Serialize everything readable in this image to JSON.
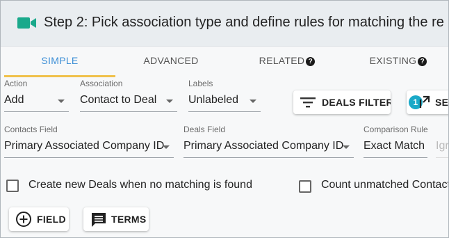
{
  "header": {
    "title": "Step 2: Pick association type and define rules for matching the re",
    "icon": "video-camera-icon",
    "icon_color": "#1aa98b"
  },
  "tabs": [
    {
      "label": "SIMPLE",
      "active": true
    },
    {
      "label": "ADVANCED",
      "active": false
    },
    {
      "label": "RELATED",
      "active": false,
      "help_icon": "?"
    },
    {
      "label": "EXISTING",
      "active": false,
      "help_icon": "?"
    }
  ],
  "row1": {
    "action": {
      "label": "Action",
      "value": "Add"
    },
    "association": {
      "label": "Association",
      "value": "Contact to Deal"
    },
    "labels": {
      "label": "Labels",
      "value": "Unlabeled"
    },
    "deals_filter_button": "DEALS FILTER",
    "settings_button": {
      "label": "SE",
      "badge": "1"
    }
  },
  "row2": {
    "contacts_field": {
      "label": "Contacts Field",
      "value": "Primary Associated Company ID"
    },
    "deals_field": {
      "label": "Deals Field",
      "value": "Primary Associated Company ID"
    },
    "comparison_rule": {
      "label": "Comparison Rule",
      "value": "Exact Match"
    },
    "ignore_field": {
      "value": "Igr"
    }
  },
  "options": {
    "create_new_deals": "Create new Deals when no matching is found",
    "count_unmatched": "Count unmatched Contact"
  },
  "buttons": {
    "field": "FIELD",
    "terms": "TERMS"
  },
  "colors": {
    "accent_tab": "#3d8fd6",
    "tab_indicator": "#f0c14b",
    "badge": "#1aa9c8"
  }
}
